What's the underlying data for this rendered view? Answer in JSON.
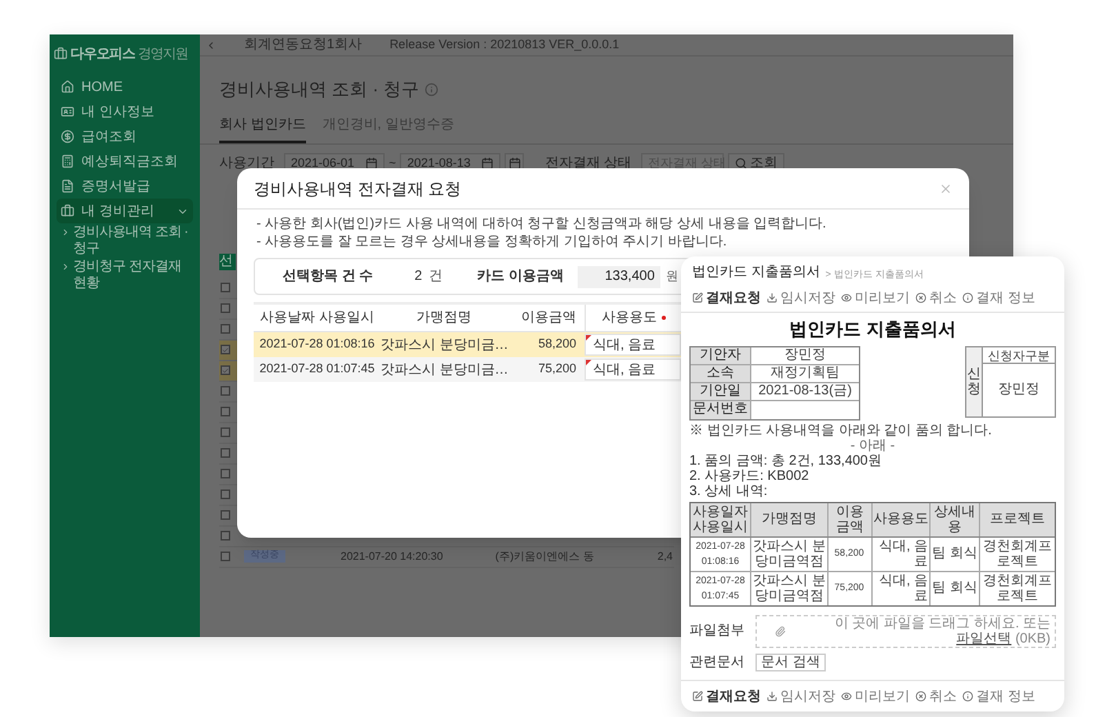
{
  "sidebar": {
    "logo": "다우오피스",
    "subtitle": "경영지원",
    "items": [
      {
        "label": "HOME",
        "selected": false
      },
      {
        "label": "내 인사정보",
        "selected": false
      },
      {
        "label": "급여조회",
        "selected": false
      },
      {
        "label": "예상퇴직금조회",
        "selected": false
      },
      {
        "label": "증명서발급",
        "selected": false
      },
      {
        "label": "내 경비관리",
        "selected": true,
        "expanded": true,
        "children": [
          {
            "label": "경비사용내역 조회 · 청구"
          },
          {
            "label": "경비청구 전자결재 현황"
          }
        ]
      }
    ]
  },
  "header": {
    "company": "회계연동요청1회사",
    "release": "Release Version : 20210813 VER_0.0.0.1"
  },
  "page": {
    "title": "경비사용내역 조회 · 청구",
    "tabs": [
      {
        "label": "회사 법인카드",
        "selected": true
      },
      {
        "label": "개인경비, 일반영수증",
        "selected": false
      }
    ],
    "filter": {
      "period_label": "사용기간",
      "start": "2021-06-01",
      "separator": "~",
      "end": "2021-08-13",
      "status_label": "전자결재 상태",
      "status_placeholder": "전자결재 상태",
      "search_button": "조회"
    },
    "list": {
      "button": "선",
      "rows": [
        {
          "checked": false
        },
        {
          "checked": false
        },
        {
          "checked": false
        },
        {
          "checked": true
        },
        {
          "checked": true
        },
        {
          "checked": false
        },
        {
          "checked": false
        },
        {
          "checked": false
        },
        {
          "checked": false
        },
        {
          "checked": false
        },
        {
          "checked": false
        },
        {
          "checked": false
        },
        {
          "checked": false
        },
        {
          "checked": false,
          "status": "작성중",
          "datetime": "2021-07-20 14:20:30",
          "merchant": "(주)키움이엔에스 동",
          "amount": "2,4"
        }
      ]
    }
  },
  "modal": {
    "title": "경비사용내역 전자결재 요청",
    "notes": [
      "- 사용한 회사(법인)카드 사용 내역에 대하여 청구할 신청금액과 해당 상세 내용을 입력합니다.",
      "- 사용용도를 잘 모르는 경우 상세내용을 정확하게 기입하여 주시기 바랍니다."
    ],
    "summary": {
      "count_label": "선택항목 건 수",
      "count": "2",
      "count_unit": "건",
      "amount_label": "카드 이용금액",
      "amount": "133,400",
      "amount_unit": "원"
    },
    "columns": [
      {
        "label": "사용날짜 사용일시",
        "required": false
      },
      {
        "label": "가맹점명",
        "required": false
      },
      {
        "label": "이용금액",
        "required": false
      },
      {
        "label": "사용용도",
        "required": true
      }
    ],
    "rows": [
      {
        "datetime": "2021-07-28 01:08:16",
        "merchant": "갓파스시 분당미금…",
        "amount": "58,200",
        "purpose": "식대, 음료",
        "selected": true
      },
      {
        "datetime": "2021-07-28 01:07:45",
        "merchant": "갓파스시 분당미금…",
        "amount": "75,200",
        "purpose": "식대, 음료",
        "selected": false
      }
    ]
  },
  "document": {
    "title": "법인카드 지출품의서",
    "breadcrumb": "> 법인카드 지출품의서",
    "toolbar": [
      "결재요청",
      "임시저장",
      "미리보기",
      "취소",
      "결재 정보"
    ],
    "heading": "법인카드 지출품의서",
    "info": [
      {
        "label": "기안자",
        "value": "장민정"
      },
      {
        "label": "소속",
        "value": "재정기획팀"
      },
      {
        "label": "기안일",
        "value": "2021-08-13(금)"
      },
      {
        "label": "문서번호"
      }
    ],
    "approval": {
      "label": "신청",
      "role": "신청자구분",
      "name": "장민정"
    },
    "note": "※ 법인카드 사용내역을 아래와 같이 품의 합니다.",
    "below": "- 아래 -",
    "lines": [
      "1. 품의 금액: 총 2건, 133,400원",
      "2. 사용카드: KB002",
      "3. 상세 내역:"
    ],
    "columns": [
      "사용일자 사용일시",
      "가맹점명",
      "이용 금액",
      "사용용도",
      "상세내용",
      "프로젝트"
    ],
    "rows": [
      [
        "2021-07-28 01:08:16",
        "갓파스시 분당미금역점",
        "58,200",
        "식대, 음료",
        "팀 회식",
        "경천회계프로젝트"
      ],
      [
        "2021-07-28 01:07:45",
        "갓파스시 분당미금역점",
        "75,200",
        "식대, 음료",
        "팀 회식",
        "경천회계프로젝트"
      ]
    ],
    "attach": {
      "label": "파일첨부",
      "hint": "이 곳에 파일을 드래그 하세요. 또는",
      "link": "파일선택",
      "size": "(0KB)"
    },
    "related": {
      "label": "관련문서",
      "button": "문서 검색"
    },
    "bottom_toolbar": [
      "결재요청",
      "임시저장",
      "미리보기",
      "취소",
      "결재 정보"
    ]
  }
}
